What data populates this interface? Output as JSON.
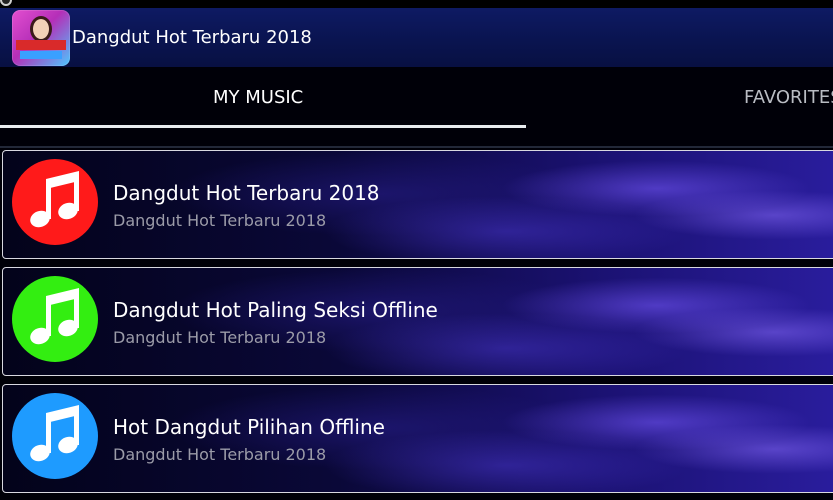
{
  "app": {
    "title": "Dangdut Hot Terbaru 2018"
  },
  "tabs": [
    {
      "label": "MY MUSIC",
      "selected": true
    },
    {
      "label": "FAVORITES",
      "selected": false
    }
  ],
  "items": [
    {
      "title": "Dangdut Hot Terbaru 2018",
      "subtitle": "Dangdut Hot Terbaru 2018",
      "icon": "music-note-icon",
      "color": "#ff1a1a"
    },
    {
      "title": "Dangdut Hot Paling Seksi Offline",
      "subtitle": "Dangdut Hot Terbaru 2018",
      "icon": "music-note-icon",
      "color": "#33ee11"
    },
    {
      "title": "Hot Dangdut Pilihan Offline",
      "subtitle": "Dangdut Hot Terbaru 2018",
      "icon": "music-note-icon",
      "color": "#1e9bff"
    }
  ],
  "colors": {
    "appbar": "#0e1a63",
    "tab_indicator": "#e8ecef"
  }
}
